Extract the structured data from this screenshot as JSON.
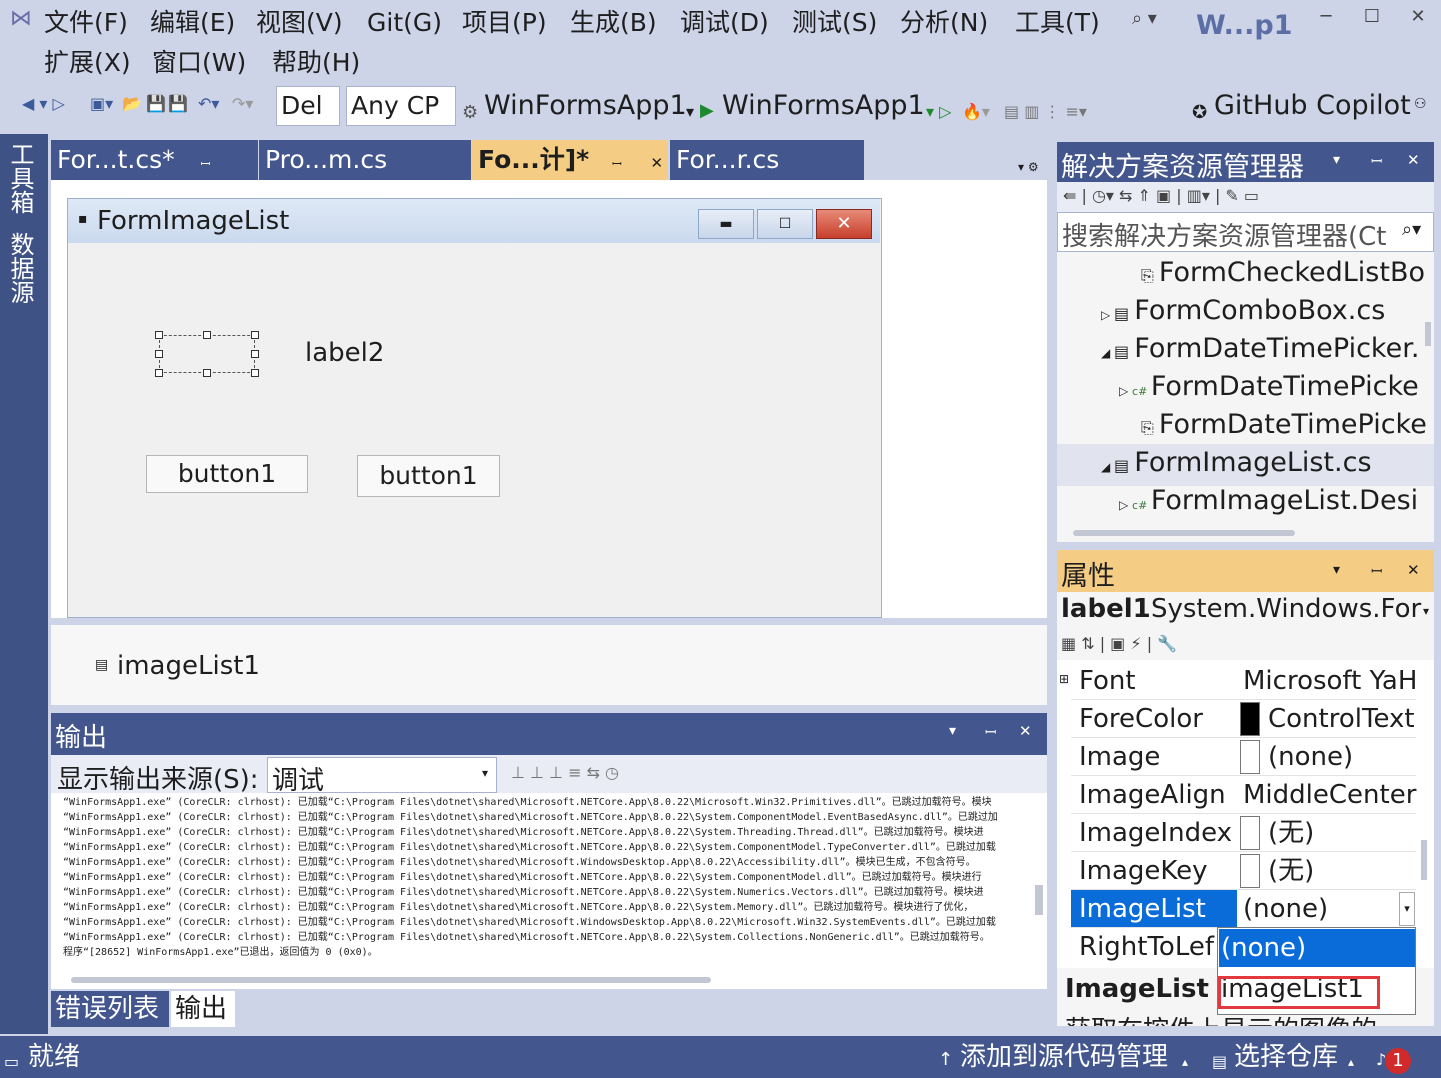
{
  "menu": {
    "items": [
      "文件(F)",
      "编辑(E)",
      "视图(V)",
      "Git(G)",
      "项目(P)",
      "生成(B)",
      "调试(D)",
      "测试(S)",
      "分析(N)",
      "工具(T)"
    ],
    "items_row2": [
      "扩展(X)",
      "窗口(W)",
      "帮助(H)"
    ],
    "window_title": "W...p1"
  },
  "toolbar": {
    "config": "Del",
    "platform": "Any CP",
    "startup_project": "WinFormsApp1",
    "run_target": "WinFormsApp1",
    "copilot": "GitHub Copilot"
  },
  "left_strip": {
    "toolbox": "工具箱",
    "datasource": "数据源"
  },
  "tabs": [
    {
      "label": "For...t.cs*"
    },
    {
      "label": "Pro...m.cs"
    },
    {
      "label": "Fo...计]*"
    },
    {
      "label": "For...r.cs"
    }
  ],
  "designer": {
    "form_title": "FormImageList",
    "label2": "label2",
    "button_a": "button1",
    "button_b": "button1",
    "tray_component": "imageList1"
  },
  "output": {
    "title": "输出",
    "source_label": "显示输出来源(S):",
    "source_value": "调试",
    "lines": [
      "“WinFormsApp1.exe” (CoreCLR: clrhost): 已加载“C:\\Program Files\\dotnet\\shared\\Microsoft.NETCore.App\\8.0.22\\Microsoft.Win32.Primitives.dll”。已跳过加载符号。模块",
      "“WinFormsApp1.exe” (CoreCLR: clrhost): 已加载“C:\\Program Files\\dotnet\\shared\\Microsoft.NETCore.App\\8.0.22\\System.ComponentModel.EventBasedAsync.dll”。已跳过加",
      "“WinFormsApp1.exe” (CoreCLR: clrhost): 已加载“C:\\Program Files\\dotnet\\shared\\Microsoft.NETCore.App\\8.0.22\\System.Threading.Thread.dll”。已跳过加载符号。模块进",
      "“WinFormsApp1.exe” (CoreCLR: clrhost): 已加载“C:\\Program Files\\dotnet\\shared\\Microsoft.NETCore.App\\8.0.22\\System.ComponentModel.TypeConverter.dll”。已跳过加载",
      "“WinFormsApp1.exe” (CoreCLR: clrhost): 已加载“C:\\Program Files\\dotnet\\shared\\Microsoft.WindowsDesktop.App\\8.0.22\\Accessibility.dll”。模块已生成，不包含符号。",
      "“WinFormsApp1.exe” (CoreCLR: clrhost): 已加载“C:\\Program Files\\dotnet\\shared\\Microsoft.NETCore.App\\8.0.22\\System.ComponentModel.dll”。已跳过加载符号。模块进行",
      "“WinFormsApp1.exe” (CoreCLR: clrhost): 已加载“C:\\Program Files\\dotnet\\shared\\Microsoft.NETCore.App\\8.0.22\\System.Numerics.Vectors.dll”。已跳过加载符号。模块进",
      "“WinFormsApp1.exe” (CoreCLR: clrhost): 已加载“C:\\Program Files\\dotnet\\shared\\Microsoft.NETCore.App\\8.0.22\\System.Memory.dll”。已跳过加载符号。模块进行了优化，",
      "“WinFormsApp1.exe” (CoreCLR: clrhost): 已加载“C:\\Program Files\\dotnet\\shared\\Microsoft.WindowsDesktop.App\\8.0.22\\Microsoft.Win32.SystemEvents.dll”。已跳过加载",
      "“WinFormsApp1.exe” (CoreCLR: clrhost): 已加载“C:\\Program Files\\dotnet\\shared\\Microsoft.NETCore.App\\8.0.22\\System.Collections.NonGeneric.dll”。已跳过加载符号。",
      "程序“[28652] WinFormsApp1.exe”已退出，返回值为 0 (0x0)。"
    ]
  },
  "bottom_tabs": {
    "errors": "错误列表",
    "output": "输出"
  },
  "solution_explorer": {
    "title": "解决方案资源管理器",
    "search_placeholder": "搜索解决方案资源管理器(Ct",
    "rows": [
      {
        "label": "FormCheckedListBo"
      },
      {
        "label": "FormComboBox.cs"
      },
      {
        "label": "FormDateTimePicker."
      },
      {
        "label": "FormDateTimePicke"
      },
      {
        "label": "FormDateTimePicke"
      },
      {
        "label": "FormImageList.cs"
      },
      {
        "label": "FormImageList.Desi"
      }
    ]
  },
  "properties": {
    "title": "属性",
    "object": "label1",
    "object_type": "System.Windows.For",
    "rows": [
      {
        "name": "Font",
        "value": "Microsoft YaH"
      },
      {
        "name": "ForeColor",
        "value": "ControlText"
      },
      {
        "name": "Image",
        "value": "(none)"
      },
      {
        "name": "ImageAlign",
        "value": "MiddleCenter"
      },
      {
        "name": "ImageIndex",
        "value": "(无)"
      },
      {
        "name": "ImageKey",
        "value": "(无)"
      },
      {
        "name": "ImageList",
        "value": "(none)"
      },
      {
        "name": "RightToLef",
        "value": ""
      }
    ],
    "dropdown_options": [
      "(none)",
      "imageList1"
    ],
    "desc_title": "ImageList",
    "desc_text": "获取在控件上显示的图像的"
  },
  "status": {
    "ready": "就绪",
    "add_source": "添加到源代码管理",
    "select_repo": "选择仓库",
    "notifications": "1"
  },
  "colors": {
    "accent_blue": "#43568e",
    "tab_active": "#f5cc84",
    "selection": "#0a6cd8",
    "highlight_box": "#e0393e"
  }
}
